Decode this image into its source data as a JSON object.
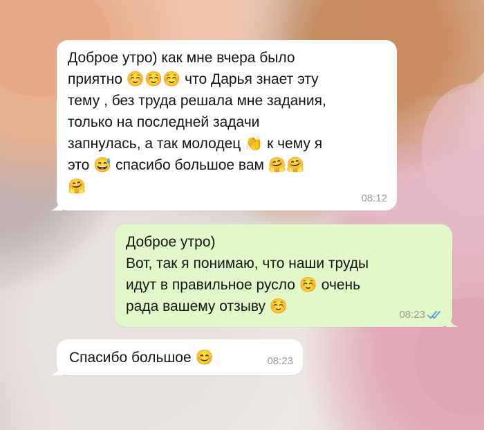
{
  "chat": {
    "messages": [
      {
        "direction": "incoming",
        "lines": [
          "Доброе утро) как мне вчера было",
          "приятно ☺️☺️☺️ что Дарья знает эту",
          "тему , без труда решала мне задания,",
          "только на последней задачи",
          "запнулась, а так молодец 👏 к чему я",
          "это 😅 спасибо большое вам 🤗🤗",
          "🤗"
        ],
        "time": "08:12"
      },
      {
        "direction": "outgoing",
        "lines": [
          "Доброе утро)",
          "Вот, так я понимаю, что наши труды",
          "идут в правильное русло ☺️ очень",
          "рада вашему отзыву ☺️"
        ],
        "time": "08:23",
        "status_icon": "double-check-read-icon"
      },
      {
        "direction": "incoming",
        "lines": [
          "Спасибо большое 😊"
        ],
        "time": "08:23"
      }
    ]
  },
  "colors": {
    "incoming_bubble": "#ffffff",
    "outgoing_bubble": "#e2f8c9",
    "read_check": "#4fa3e0",
    "timestamp": "#9a9a9a"
  }
}
